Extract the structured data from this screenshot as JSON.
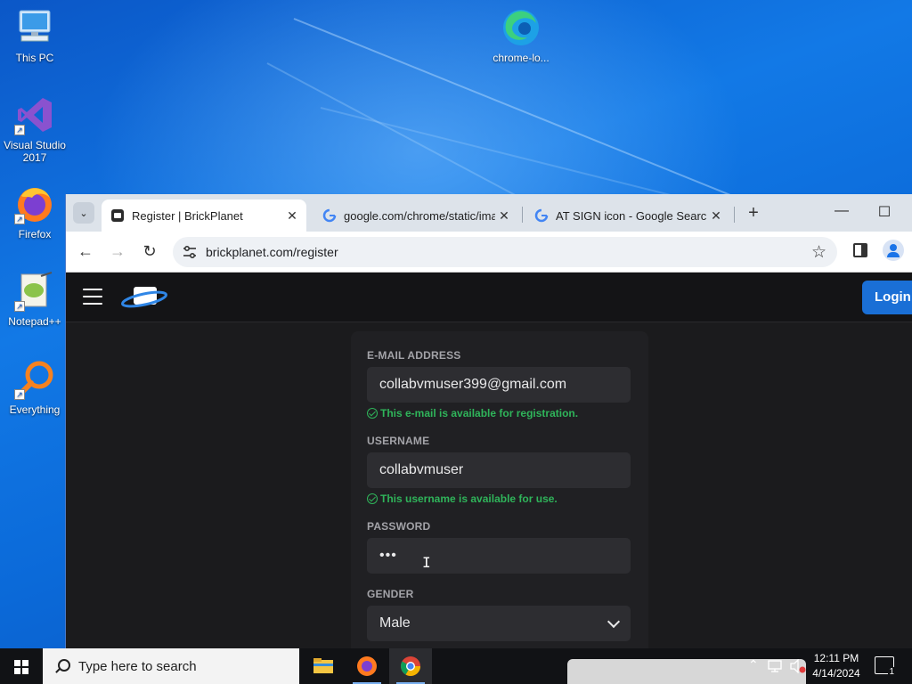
{
  "desktop": {
    "icons": [
      {
        "label": "This PC",
        "icon": "computer-icon"
      },
      {
        "label": "chrome-lo...",
        "icon": "edge-icon"
      },
      {
        "label": "Visual Studio 2017",
        "icon": "visual-studio-icon"
      },
      {
        "label": "Firefox",
        "icon": "firefox-icon"
      },
      {
        "label": "Notepad++",
        "icon": "notepadpp-icon"
      },
      {
        "label": "Everything",
        "icon": "everything-search-icon"
      }
    ]
  },
  "browser": {
    "tabs": [
      {
        "title": "Register | BrickPlanet",
        "icon": "brickplanet-favicon",
        "active": true
      },
      {
        "title": "google.com/chrome/static/images/...",
        "icon": "google-favicon",
        "active": false
      },
      {
        "title": "AT SIGN icon - Google Search",
        "icon": "google-favicon",
        "active": false
      }
    ],
    "tab_close": "✕",
    "new_tab": "+",
    "url": "brickplanet.com/register"
  },
  "site": {
    "login_label": "Login",
    "colors": {
      "accent": "#1a6fd6",
      "success": "#2fb45a",
      "background": "#1b1b1d"
    }
  },
  "form": {
    "email": {
      "label": "E-MAIL ADDRESS",
      "value": "collabvmuser399@gmail.com",
      "status": "This e-mail is available for registration."
    },
    "username": {
      "label": "USERNAME",
      "value": "collabvmuser",
      "status": "This username is available for use."
    },
    "password": {
      "label": "PASSWORD",
      "value": "•••"
    },
    "gender": {
      "label": "GENDER",
      "value": "Male"
    }
  },
  "taskbar": {
    "search_placeholder": "Type here to search",
    "apps": [
      "file-explorer-icon",
      "firefox-icon",
      "chrome-icon"
    ],
    "time": "12:11 PM",
    "date": "4/14/2024",
    "notification_count": "1"
  }
}
